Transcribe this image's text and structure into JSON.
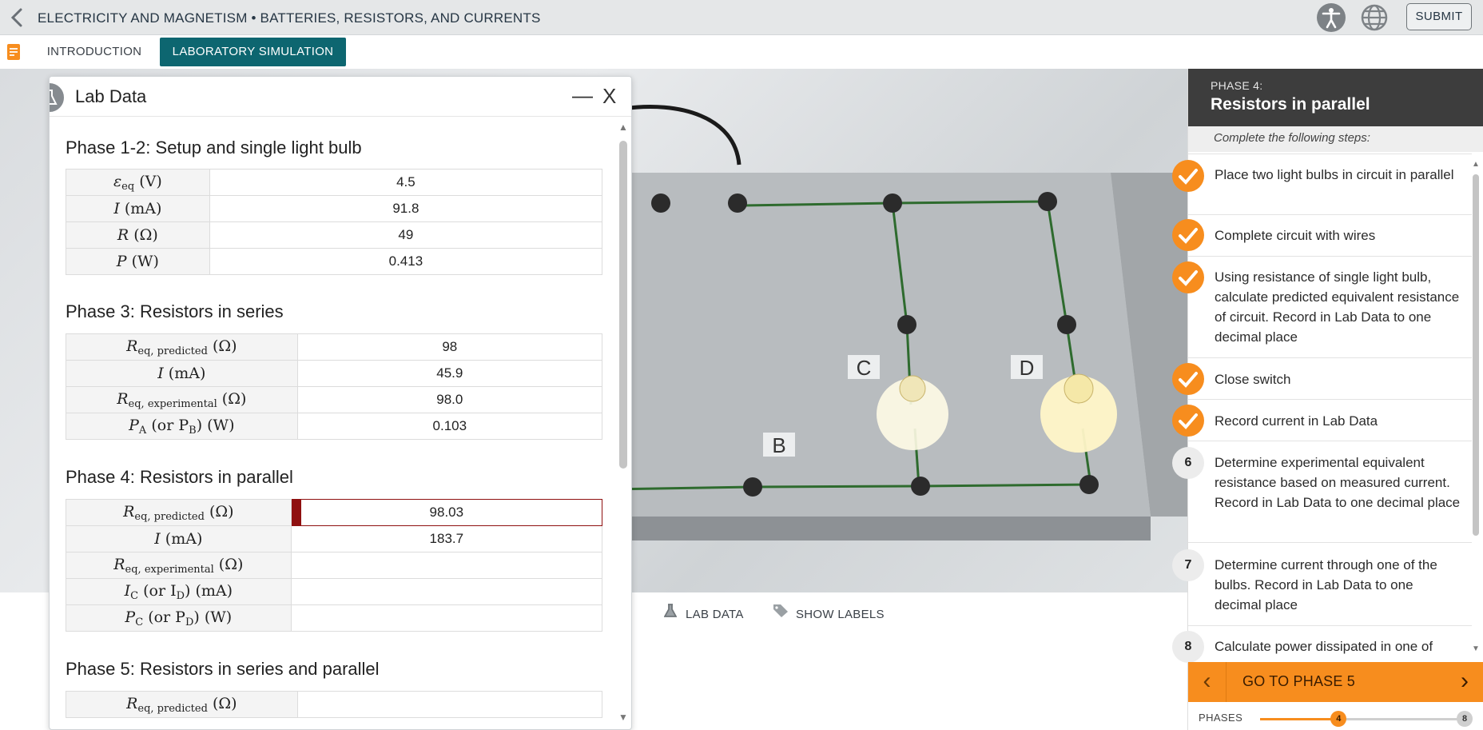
{
  "header": {
    "title": "ELECTRICITY AND MAGNETISM • BATTERIES, RESISTORS, AND CURRENTS",
    "submit_label": "SUBMIT"
  },
  "tabs": [
    {
      "label": "INTRODUCTION",
      "active": false
    },
    {
      "label": "LABORATORY SIMULATION",
      "active": true
    }
  ],
  "scene": {
    "labels": [
      "B",
      "C",
      "D"
    ]
  },
  "toolbar": {
    "lab_data_label": "LAB DATA",
    "show_labels_label": "SHOW LABELS"
  },
  "lab_data": {
    "title": "Lab Data",
    "minimize_symbol": "—",
    "close_symbol": "X",
    "sections": [
      {
        "title": "Phase 1-2: Setup and single light bulb",
        "rows": [
          {
            "label_main": "ε",
            "label_sub": "eq",
            "label_unit": " (V)",
            "value": "4.5"
          },
          {
            "label_main": "I",
            "label_sub": "",
            "label_unit": " (mA)",
            "value": "91.8"
          },
          {
            "label_main": "R",
            "label_sub": "",
            "label_unit": " (Ω)",
            "value": "49"
          },
          {
            "label_main": "P",
            "label_sub": "",
            "label_unit": " (W)",
            "value": "0.413"
          }
        ]
      },
      {
        "title": "Phase 3: Resistors in series",
        "rows": [
          {
            "label_main": "R",
            "label_sub": "eq, predicted",
            "label_unit": " (Ω)",
            "value": "98"
          },
          {
            "label_main": "I",
            "label_sub": "",
            "label_unit": " (mA)",
            "value": "45.9"
          },
          {
            "label_main": "R",
            "label_sub": "eq, experimental",
            "label_unit": " (Ω)",
            "value": "98.0"
          },
          {
            "label_main": "P",
            "label_sub": "A",
            "label_unit": " (or P",
            "label_sub2": "B",
            "label_unit2": ") (W)",
            "value": "0.103"
          }
        ]
      },
      {
        "title": "Phase 4: Resistors in parallel",
        "rows": [
          {
            "label_main": "R",
            "label_sub": "eq, predicted",
            "label_unit": " (Ω)",
            "value": "98.03"
          },
          {
            "label_main": "I",
            "label_sub": "",
            "label_unit": " (mA)",
            "value": "183.7"
          },
          {
            "label_main": "R",
            "label_sub": "eq, experimental",
            "label_unit": " (Ω)",
            "value": ""
          },
          {
            "label_main": "I",
            "label_sub": "C",
            "label_unit": " (or I",
            "label_sub2": "D",
            "label_unit2": ") (mA)",
            "value": ""
          },
          {
            "label_main": "P",
            "label_sub": "C",
            "label_unit": " (or P",
            "label_sub2": "D",
            "label_unit2": ") (W)",
            "value": ""
          }
        ]
      },
      {
        "title": "Phase 5: Resistors in series and parallel",
        "rows": [
          {
            "label_main": "R",
            "label_sub": "eq, predicted",
            "label_unit": " (Ω)",
            "value": ""
          }
        ]
      }
    ]
  },
  "phase_panel": {
    "phase_number": "PHASE 4:",
    "phase_title": "Resistors in parallel",
    "steps_intro": "Complete the following steps:",
    "steps": [
      {
        "status": "done",
        "number": "",
        "text": "Place two light bulbs in circuit in parallel"
      },
      {
        "status": "done",
        "number": "",
        "text": "Complete circuit with wires"
      },
      {
        "status": "done",
        "number": "",
        "text": "Using resistance of single light bulb, calculate predicted equivalent resistance of circuit. Record in Lab Data to one decimal place"
      },
      {
        "status": "done",
        "number": "",
        "text": "Close switch"
      },
      {
        "status": "done",
        "number": "",
        "text": "Record current in Lab Data"
      },
      {
        "status": "todo",
        "number": "6",
        "text": "Determine experimental equivalent resistance based on measured current. Record in Lab Data to one decimal place"
      },
      {
        "status": "todo",
        "number": "7",
        "text": "Determine current through one of the bulbs. Record in Lab Data to one decimal place"
      },
      {
        "status": "todo",
        "number": "8",
        "text": "Calculate power dissipated in one of"
      }
    ],
    "go_next_label": "GO TO PHASE 5",
    "phases_label": "PHASES",
    "current_phase": "4",
    "total_phases": "8",
    "progress_fraction": 0.375
  },
  "colors": {
    "accent": "#f78d1e",
    "tab_active": "#0d6670",
    "header_dark": "#3d3d3d",
    "active_field": "#8f1010"
  }
}
